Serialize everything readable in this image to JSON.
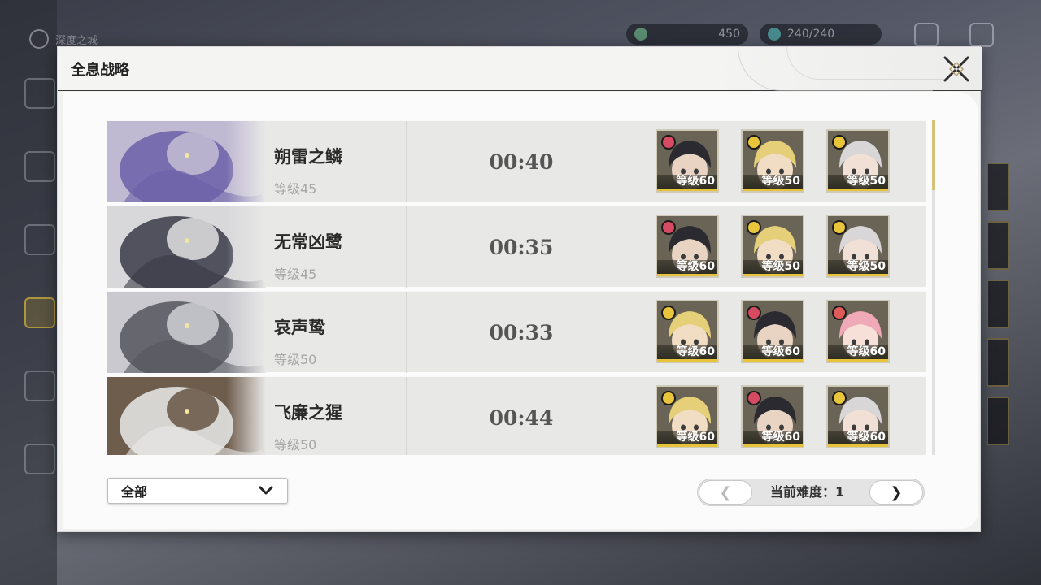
{
  "window": {
    "title": "全息战略"
  },
  "background_hud": {
    "top_left_label": "深度之城",
    "currency_value": "450",
    "stamina_value": "240/240"
  },
  "bosses": [
    {
      "name": "朔雷之鳞",
      "level": "等级45",
      "clear_time": "00:40",
      "team": [
        {
          "name": "dark-hair-character",
          "element": "fire",
          "level": "等级60",
          "hair": "#2a2a30",
          "skin": "#e9d3c2"
        },
        {
          "name": "blonde-character",
          "element": "light",
          "level": "等级50",
          "hair": "#e6cf79",
          "skin": "#f1dcc4"
        },
        {
          "name": "silver-hair-character",
          "element": "light",
          "level": "等级50",
          "hair": "#d9d6d8",
          "skin": "#f0e0d6"
        }
      ],
      "art_colors": [
        "#6b5fa8",
        "#bfb9d2"
      ]
    },
    {
      "name": "无常凶鹭",
      "level": "等级45",
      "clear_time": "00:35",
      "team": [
        {
          "name": "dark-hair-character",
          "element": "fire",
          "level": "等级60",
          "hair": "#2a2a30",
          "skin": "#e9d3c2"
        },
        {
          "name": "blonde-character",
          "element": "light",
          "level": "等级50",
          "hair": "#e6cf79",
          "skin": "#f1dcc4"
        },
        {
          "name": "silver-hair-character",
          "element": "light",
          "level": "等级50",
          "hair": "#d9d6d8",
          "skin": "#f0e0d6"
        }
      ],
      "art_colors": [
        "#3b3b48",
        "#d8d8da"
      ]
    },
    {
      "name": "哀声鸷",
      "level": "等级50",
      "clear_time": "00:33",
      "team": [
        {
          "name": "blonde-character",
          "element": "light",
          "level": "等级60",
          "hair": "#e6cf79",
          "skin": "#f1dcc4"
        },
        {
          "name": "dark-hair-character",
          "element": "fire",
          "level": "等级60",
          "hair": "#2a2a30",
          "skin": "#e9d3c2"
        },
        {
          "name": "pink-hair-character",
          "element": "pink",
          "level": "等级60",
          "hair": "#f0a9b6",
          "skin": "#f6e0d8"
        }
      ],
      "art_colors": [
        "#55555e",
        "#c9c9cf"
      ]
    },
    {
      "name": "飞廉之猩",
      "level": "等级50",
      "clear_time": "00:44",
      "team": [
        {
          "name": "blonde-character",
          "element": "light",
          "level": "等级60",
          "hair": "#e6cf79",
          "skin": "#f1dcc4"
        },
        {
          "name": "dark-hair-character",
          "element": "fire",
          "level": "等级60",
          "hair": "#2a2a30",
          "skin": "#e9d3c2"
        },
        {
          "name": "silver-hair-character",
          "element": "light",
          "level": "等级60",
          "hair": "#d9d6d8",
          "skin": "#f0e0d6"
        }
      ],
      "art_colors": [
        "#eaeaea",
        "#6e5c4c"
      ]
    }
  ],
  "filter": {
    "selected": "全部"
  },
  "pager": {
    "difficulty_label": "当前难度：1",
    "prev_glyph": "❮",
    "next_glyph": "❯"
  },
  "colors": {
    "accent_gold": "#e7c33a",
    "scroll_thumb": "#d7c07c"
  }
}
